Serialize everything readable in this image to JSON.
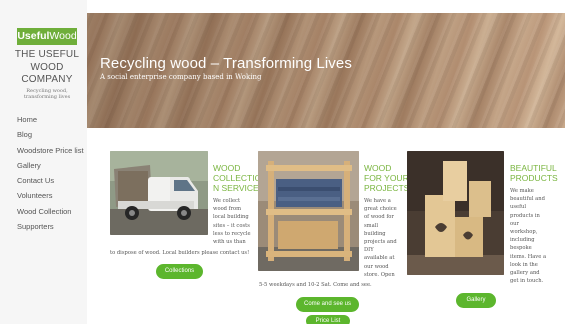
{
  "logo": {
    "part1": "Useful",
    "part2": "Wood"
  },
  "site": {
    "title_lines": [
      "THE USEFUL",
      "WOOD",
      "COMPANY"
    ],
    "tagline_lines": [
      "Recycling wood,",
      "transforming lives"
    ]
  },
  "nav": [
    "Home",
    "Blog",
    "Woodstore Price list",
    "Gallery",
    "Contact Us",
    "Volunteers",
    "Wood Collection",
    "Supporters"
  ],
  "hero": {
    "title": "Recycling wood – Transforming Lives",
    "subtitle": "A social enterprise company based in Woking"
  },
  "cards": [
    {
      "title_lines": [
        "WOOD",
        "COLLECTIO",
        "N SERVICE"
      ],
      "text_lines": [
        "We collect",
        "wood from",
        "local building",
        "sites – it costs",
        "less to recycle",
        "with us than"
      ],
      "tail": "to dispose of wood. Local builders please contact us!",
      "button": "Collections",
      "image": "van-image"
    },
    {
      "title_lines": [
        "WOOD",
        "FOR YOUR",
        "PROJECTS"
      ],
      "text_lines": [
        "We have a",
        "great choice",
        "of wood for",
        "small",
        "building",
        "projects and",
        "DIY",
        "available at",
        "our wood",
        "store. Open"
      ],
      "tail": "5-5 weekdays and 10-2 Sat. Come and see.",
      "buttons": [
        "Come and see us",
        "Price List"
      ],
      "image": "shelf-image"
    },
    {
      "title_lines": [
        "BEAUTIFUL",
        "PRODUCTS"
      ],
      "text_lines": [
        "We make",
        "beautiful and",
        "useful",
        "products in",
        "our",
        "workshop,",
        "including",
        "bespoke",
        "items. Have a",
        "look in the",
        "gallery and",
        "get in touch."
      ],
      "button": "Gallery",
      "image": "candle-holder-image"
    }
  ],
  "colors": {
    "accent_green": "#5cb62d",
    "title_green": "#7ab540",
    "logo_green": "#6fae3a"
  }
}
